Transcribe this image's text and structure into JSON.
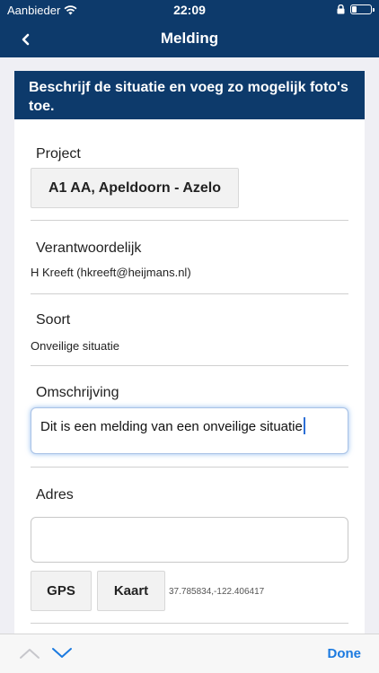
{
  "status_bar": {
    "carrier": "Aanbieder",
    "time": "22:09"
  },
  "nav": {
    "title": "Melding"
  },
  "banner": {
    "text": "Beschrijf de situatie en voeg zo mogelijk foto's toe."
  },
  "project": {
    "label": "Project",
    "value": "A1 AA, Apeldoorn - Azelo"
  },
  "verantwoordelijk": {
    "label": "Verantwoordelijk",
    "value": "H Kreeft (hkreeft@heijmans.nl)"
  },
  "soort": {
    "label": "Soort",
    "value": "Onveilige situatie"
  },
  "omschrijving": {
    "label": "Omschrijving",
    "value": "Dit is een melding van een onveilige situatie"
  },
  "adres": {
    "label": "Adres",
    "value": "",
    "gps_label": "GPS",
    "kaart_label": "Kaart",
    "coordinates": "37.785834,-122.406417"
  },
  "keyboard_toolbar": {
    "done_label": "Done"
  },
  "colors": {
    "brand": "#0d3a6b",
    "accent": "#1b7ae0",
    "background": "#efeff4"
  }
}
